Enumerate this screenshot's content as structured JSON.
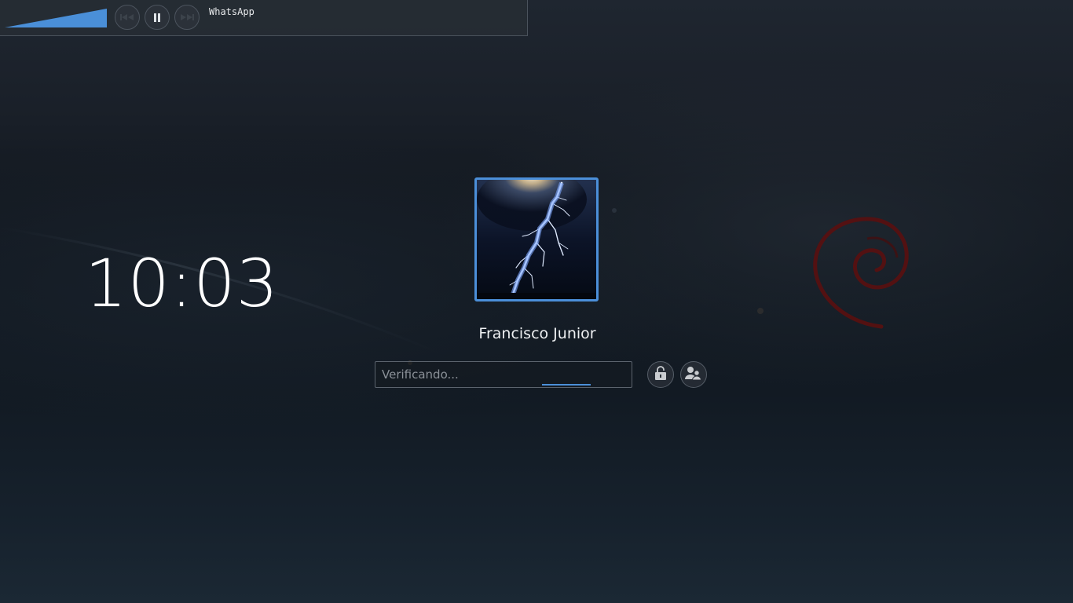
{
  "media_player": {
    "volume_percent": 100,
    "title": "WhatsApp",
    "icons": {
      "previous": "previous-track-icon",
      "pause": "pause-icon",
      "next": "next-track-icon"
    }
  },
  "clock": {
    "time": "10:03"
  },
  "user": {
    "name": "Francisco Junior",
    "avatar": "lightning-photo"
  },
  "password": {
    "placeholder": "Verificando...",
    "value": ""
  },
  "actions": {
    "unlock_icon": "unlock-icon",
    "switch_user_icon": "switch-user-icon"
  },
  "background": {
    "logo": "debian-swirl-logo"
  },
  "colors": {
    "accent": "#4b8fd9",
    "logo": "#5a1010"
  }
}
